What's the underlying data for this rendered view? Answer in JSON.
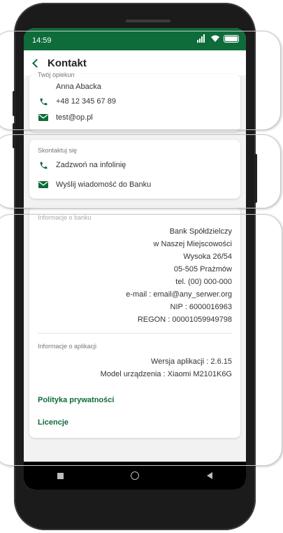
{
  "status_bar": {
    "time": "14:59"
  },
  "header": {
    "title": "Kontakt"
  },
  "advisor": {
    "label": "Twój opiekun",
    "name": "Anna Abacka",
    "phone": "+48 12 345 67 89",
    "email": "test@op.pl"
  },
  "contact": {
    "label": "Skontaktuj się",
    "call": "Zadzwoń na infolinię",
    "message": "Wyślij wiadomość do Banku"
  },
  "bank_info": {
    "label": "Informacje o banku",
    "lines": [
      "Bank Spółdzielczy",
      "w Naszej Miejscowości",
      "Wysoka 26/54",
      "05-505 Prażmów",
      "tel. (00) 000-000",
      "e-mail : email@any_serwer.org",
      "NIP : 6000016963",
      "REGON : 00001059949798"
    ]
  },
  "app_info": {
    "label": "Informacje o aplikacji",
    "version": "Wersja aplikacji : 2.6.15",
    "device": "Model urządzenia : Xiaomi M2101K6G"
  },
  "links": {
    "privacy": "Polityka prywatności",
    "licenses": "Licencje"
  },
  "colors": {
    "brand_green": "#0e6b3a",
    "background": "#f2f2f2"
  }
}
